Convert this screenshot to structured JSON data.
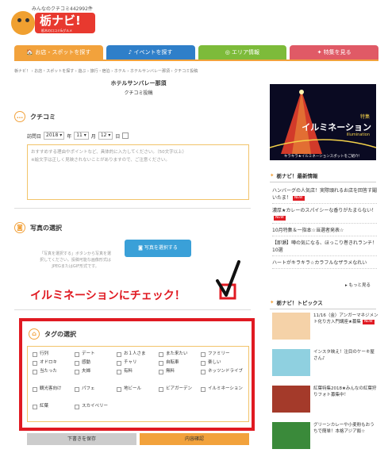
{
  "header": {
    "tagline": "みんなのクチコミ442992件",
    "logo_text": "栃ナビ!",
    "logo_sub": "栃木の口コミ&グルメ"
  },
  "nav": {
    "tabs": [
      {
        "label": "お店・スポットを探す",
        "color": "#f2a23c",
        "icon": "shop-icon"
      },
      {
        "label": "イベントを探す",
        "color": "#2f7fc9",
        "icon": "music-note-icon"
      },
      {
        "label": "エリア情報",
        "color": "#7dbb3a",
        "icon": "compass-icon"
      },
      {
        "label": "特集を見る",
        "color": "#e05a66",
        "icon": "megaphone-icon"
      }
    ]
  },
  "breadcrumb": [
    "栃ナビ！",
    "お店・スポットを探す",
    "遊ぶ",
    "旅行・宿泊",
    "ホテル",
    "ホテルサンバレー那須",
    "クチコミ投稿"
  ],
  "page": {
    "title": "ホテルサンバレー那須",
    "subtitle": "クチコミ投稿"
  },
  "review": {
    "heading": "クチコミ",
    "date_label": "訪問日",
    "year": "2018",
    "year_unit": "年",
    "month": "11",
    "month_unit": "月",
    "day": "12",
    "day_unit": "日",
    "placeholder_line1": "おすすめする理由やポイントなど、具体的に入力してください。（50文字以上）",
    "placeholder_line2": "※絵文字は正しく見映されないことがありますので、ご注意ください。"
  },
  "photo": {
    "heading": "写真の選択",
    "note": "「写真を選択する」ボタンから写真を選択してください。投稿可能な画像形式はJPEGまたはGIF形式です。",
    "button_label": "写真を選択する"
  },
  "annotation": {
    "text": "イルミネーションにチェック！"
  },
  "tags": {
    "heading": "タグの選択",
    "items": [
      "行列",
      "デート",
      "お１人さま",
      "また来たい",
      "ファミリー",
      "オドロキ",
      "感動",
      "チャリ",
      "自転車",
      "楽しい",
      "当たった",
      "夫婦",
      "有料",
      "無料",
      "ネッツンドライブ",
      "観光客向け",
      "パフェ",
      "地ビール",
      "ビアガーデン",
      "イルミネーション",
      "紅葉",
      "スカイベリー"
    ],
    "checked": []
  },
  "actions": {
    "save_draft": "下書きを保存",
    "confirm": "内容確認"
  },
  "sidebar": {
    "banner": {
      "line1": "特集",
      "line2": "イルミネーション",
      "line3": "illumination",
      "line4": "キラキラ★イルミネーションスポットをご紹介！"
    },
    "news_heading": "栃ナビ！最新情報",
    "news": [
      {
        "text": "ハンバーグの人気店！実際頭れるお店を回答す鬮いたま！",
        "new": "NEW"
      },
      {
        "text": "濃厚★カレーのスパイシーな香りがたまらない！",
        "new": "NEW"
      },
      {
        "text": "10月特集＆一指本☆当選者発表☆",
        "new": ""
      },
      {
        "text": "【即瀬】噂の気になる、ほっこり巻きれランチ！10選",
        "new": ""
      },
      {
        "text": "ハートがキラキラ☆カラフルなザラメなれい",
        "new": ""
      }
    ],
    "more": "もっと見る",
    "topics_heading": "栃ナビ！トピックス",
    "topics": [
      {
        "text": "11/16（金）アンガーマネジメント化り方入門講座★募集",
        "new": "NEW"
      },
      {
        "text": "インスタ映え！注目のケーキ屋さん♪",
        "new": ""
      },
      {
        "text": "紅葉特集2018★みんなの紅葉狩りフォト募集中！",
        "new": ""
      },
      {
        "text": "グリーンカレーや小麦粉もおうちで簡単！本格アジア飯☆",
        "new": ""
      }
    ]
  }
}
